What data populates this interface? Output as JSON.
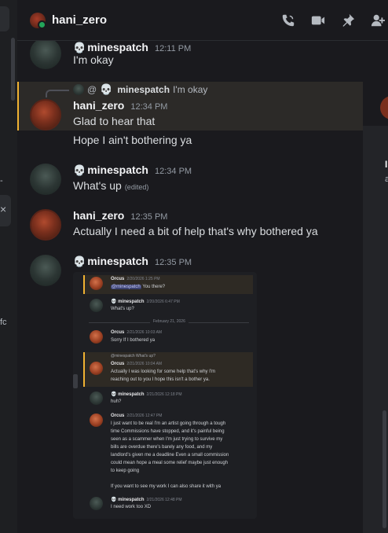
{
  "colors": {
    "accent_highlight": "#f0b232",
    "online": "#23a55a",
    "background": "#1a1a1e"
  },
  "sidebar": {
    "glyph_1": "-",
    "glyph_2": "×",
    "glyph_3": "fc"
  },
  "header": {
    "title": "hani_zero",
    "icons": [
      "phone-call-icon",
      "video-camera-icon",
      "pin-icon",
      "add-member-icon"
    ]
  },
  "messages": [
    {
      "author": "minespatch",
      "time": "12:11 PM",
      "text": "I'm okay"
    },
    {
      "author": "hani_zero",
      "time": "12:34 PM",
      "text": "Glad to hear that",
      "reply": {
        "at": "@",
        "author": "minespatch",
        "text": "I'm okay"
      }
    },
    {
      "text": "Hope I ain't bothering ya"
    },
    {
      "author": "minespatch",
      "time": "12:34 PM",
      "text": "What's up",
      "edited": "(edited)"
    },
    {
      "author": "hani_zero",
      "time": "12:35 PM",
      "text": "Actually I need a bit of help that's why bothered ya"
    },
    {
      "author": "minespatch",
      "time": "12:35 PM"
    }
  ],
  "embedded": {
    "m1": {
      "author": "Orcus",
      "time": "2/20/2026 1:25 PM",
      "mention": "@minespatch",
      "text": "You there?"
    },
    "m2": {
      "author": "minespatch",
      "time": "2/20/2026 6:47 PM",
      "text": "What's up?"
    },
    "divider": "February 21, 2026",
    "m3": {
      "author": "Orcus",
      "time": "2/21/2026 10:03 AM",
      "text": "Sorry If I bothered ya"
    },
    "m4": {
      "reply_author": "@minespatch",
      "reply_text": "What's up?",
      "author": "Orcus",
      "time": "2/21/2026 10:04 AM",
      "line1": "Actually I was looking for some help that's why I'm",
      "line2": "reaching out to you I hope this isn't a bother ya."
    },
    "m5": {
      "author": "minespatch",
      "time": "2/21/2026 12:18 PM",
      "text": "huh?"
    },
    "m6": {
      "author": "Orcus",
      "time": "2/21/2026 12:47 PM",
      "lines": [
        "I just want to be real I'm an artist going through a tough",
        "time Commissions have stopped, and it's painful being",
        "seen as a scammer when I'm just trying to survive my",
        "bills are overdue there's barely any food, and my",
        "landlord's given me a deadline Even a small commission",
        "could mean hope a meal some relief maybe just enough",
        "to keep going",
        "",
        "If you want to see my work I can also share it with ya"
      ]
    },
    "m7": {
      "author": "minespatch",
      "time": "2/21/2026 12:48 PM",
      "text": "I need work too XD"
    }
  },
  "right_panel": {
    "glyph_1": "I",
    "glyph_2": "a"
  }
}
